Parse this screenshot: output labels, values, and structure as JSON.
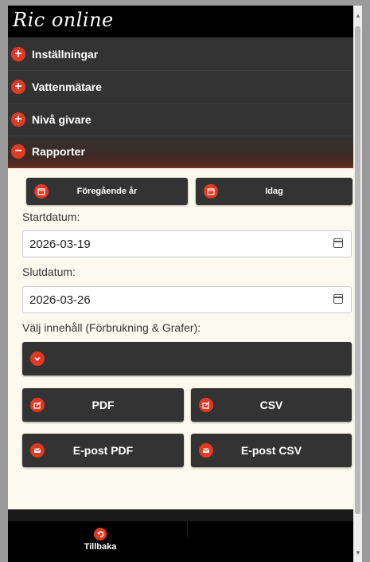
{
  "app": {
    "logo_text": "Ric online"
  },
  "accordion": {
    "items": [
      {
        "label": "Inställningar",
        "state": "collapsed"
      },
      {
        "label": "Vattenmätare",
        "state": "collapsed"
      },
      {
        "label": "Nivå givare",
        "state": "collapsed"
      },
      {
        "label": "Rapporter",
        "state": "expanded"
      }
    ]
  },
  "reports": {
    "prev_year_label": "Föregående år",
    "today_label": "Idag",
    "start_label": "Startdatum:",
    "start_value": "2026-03-19",
    "end_label": "Slutdatum:",
    "end_value": "2026-03-26",
    "content_label": "Välj innehåll (Förbrukning & Grafer):",
    "pdf_label": "PDF",
    "csv_label": "CSV",
    "email_pdf_label": "E-post PDF",
    "email_csv_label": "E-post CSV"
  },
  "footer": {
    "back_label": "Tillbaka"
  },
  "colors": {
    "accent": "#e03a24",
    "dark": "#333333",
    "content_bg": "#fcfaee"
  }
}
